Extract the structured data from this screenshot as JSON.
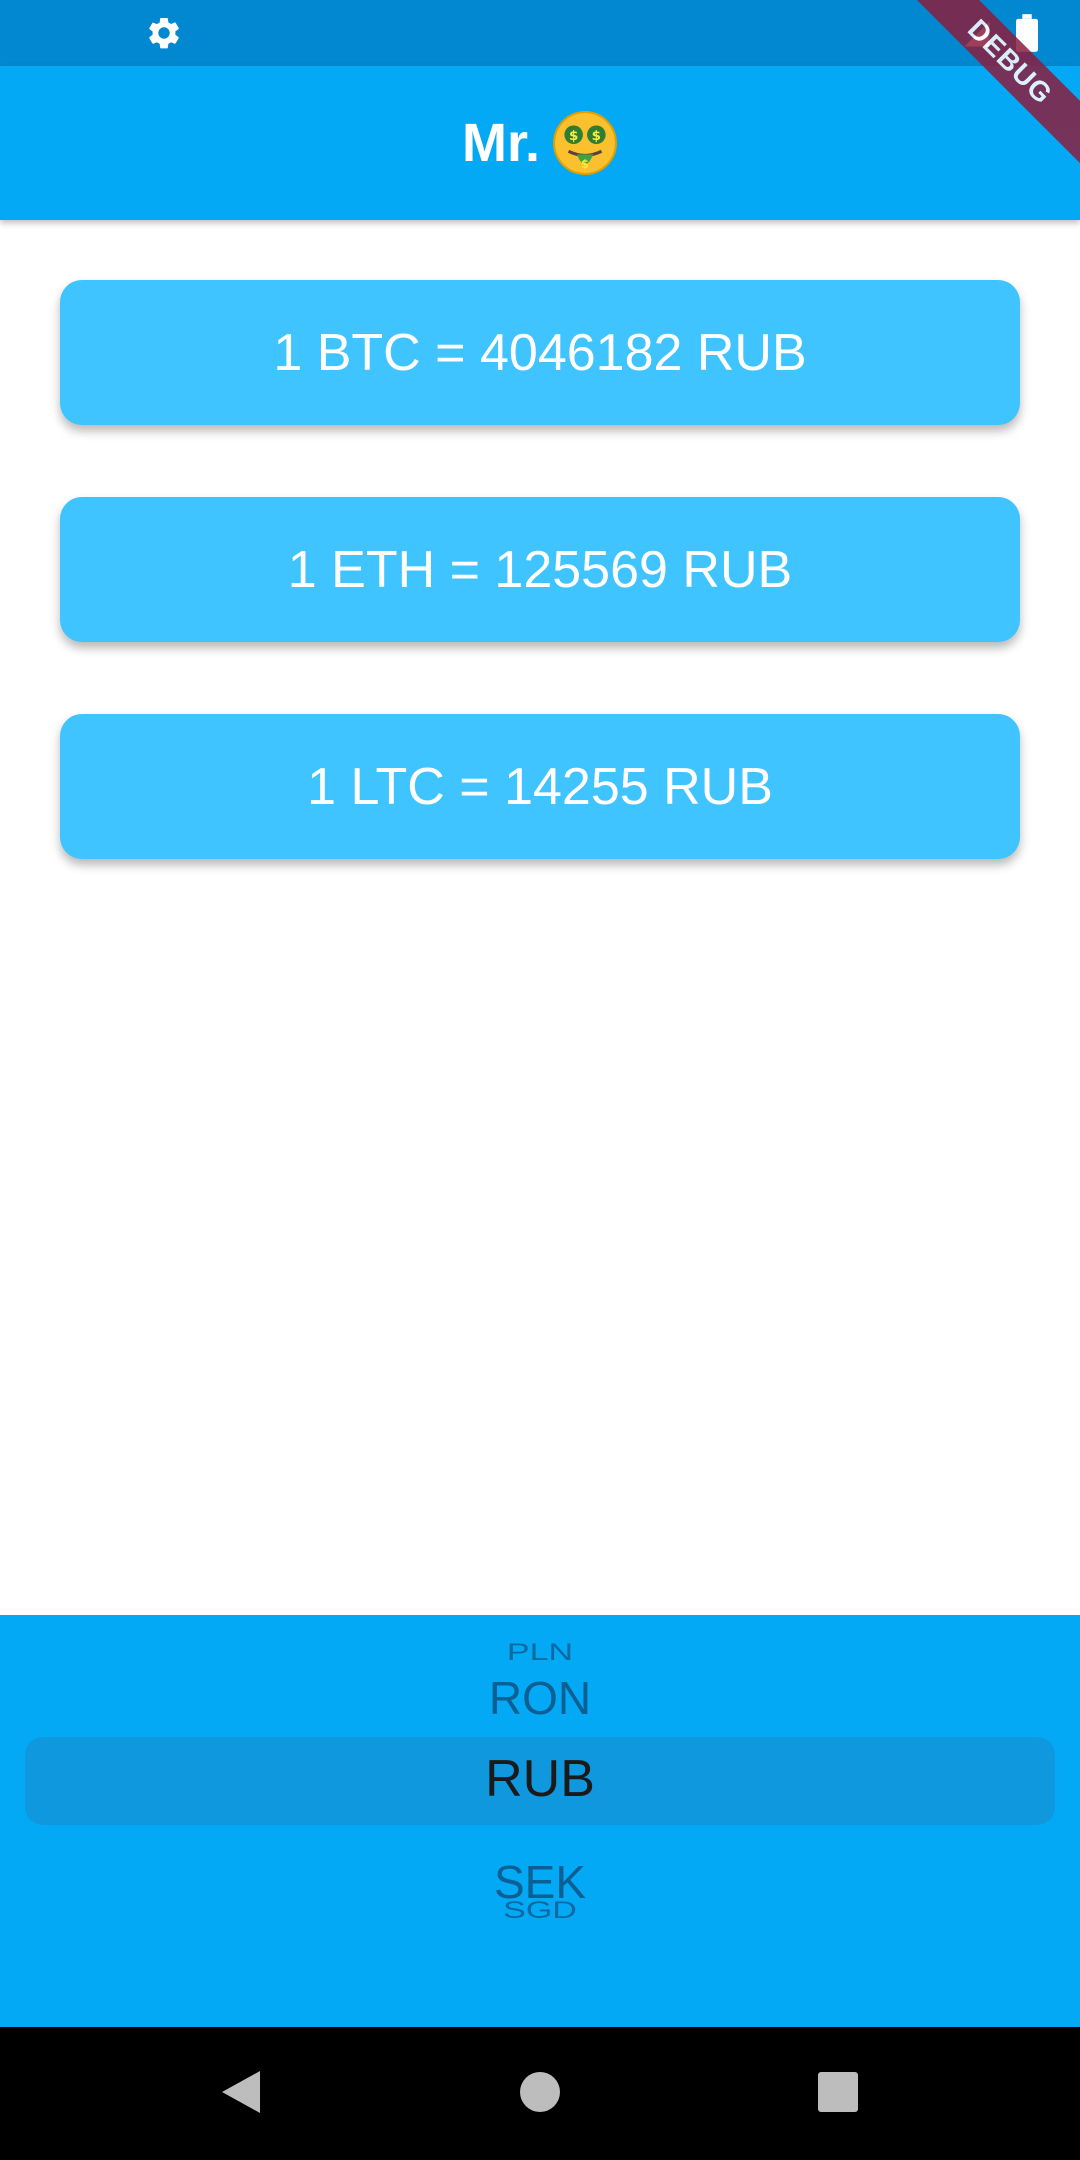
{
  "status_bar": {
    "left_icon": "gear-icon",
    "right_icons": [
      "signal-icon",
      "battery-icon"
    ],
    "colors": {
      "background": "#0288d1"
    }
  },
  "app_bar": {
    "title": "Mr.",
    "emoji": "money-mouth-face-icon",
    "background": "#03a9f4"
  },
  "debug_banner": {
    "label": "DEBUG"
  },
  "rates": [
    {
      "text": "1 BTC = 4046182 RUB",
      "crypto": "BTC",
      "value": "4046182",
      "currency": "RUB"
    },
    {
      "text": "1 ETH = 125569 RUB",
      "crypto": "ETH",
      "value": "125569",
      "currency": "RUB"
    },
    {
      "text": "1 LTC = 14255 RUB",
      "crypto": "LTC",
      "value": "14255",
      "currency": "RUB"
    }
  ],
  "currency_picker": {
    "items": [
      "PLN",
      "RON",
      "RUB",
      "SEK",
      "SGD"
    ],
    "selected": "RUB",
    "background": "#03a9f4"
  },
  "navigation_bar": {
    "buttons": [
      "back-icon",
      "home-icon",
      "recents-icon"
    ]
  },
  "colors": {
    "card": "#40c4ff",
    "card_text": "#ffffff"
  }
}
